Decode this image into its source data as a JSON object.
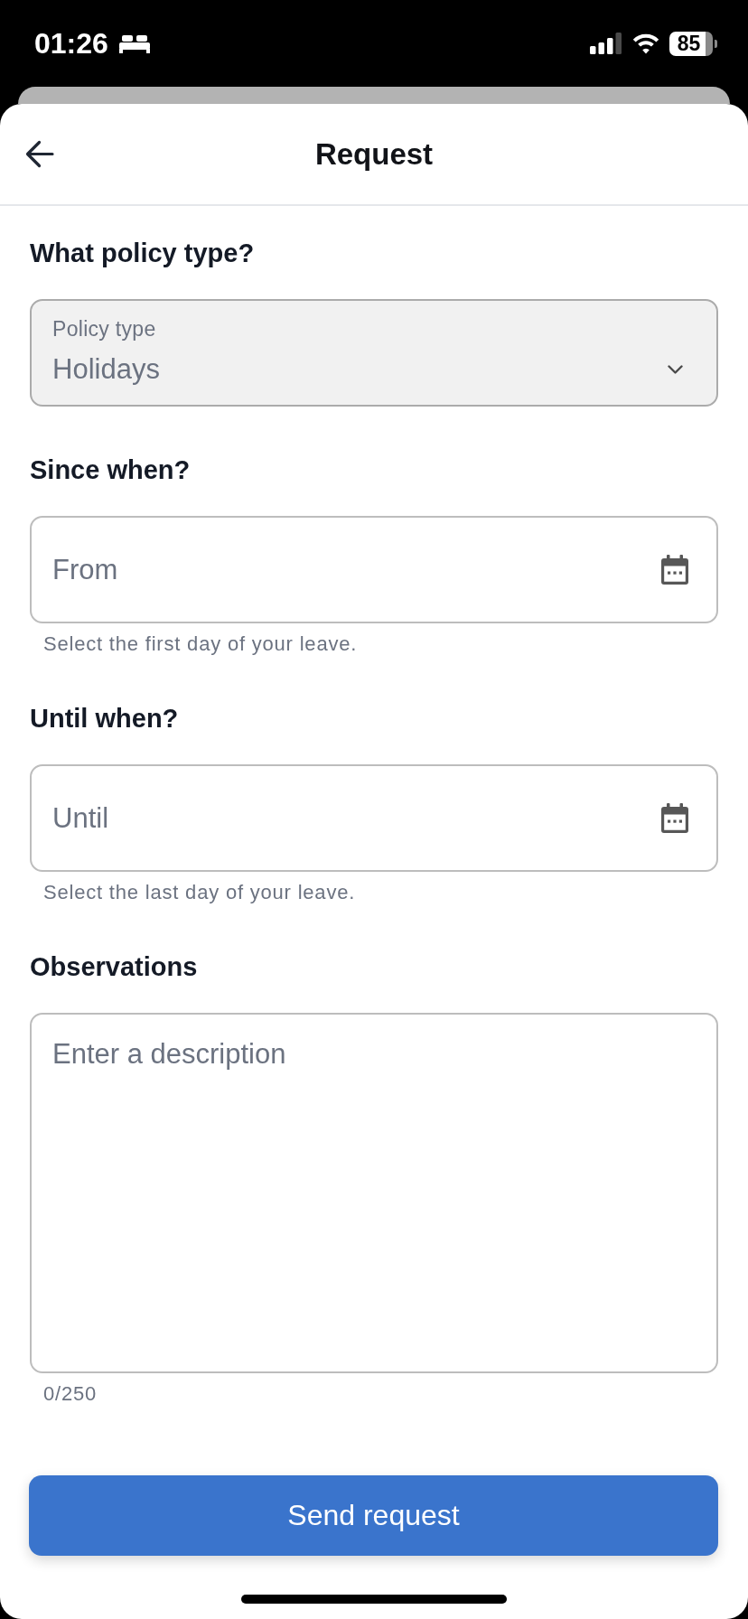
{
  "status_bar": {
    "time": "01:26",
    "battery": "85"
  },
  "header": {
    "title": "Request"
  },
  "sections": [
    {
      "kind": "select",
      "question": "What policy type?",
      "label": "Policy type",
      "value": "Holidays"
    },
    {
      "kind": "date",
      "question": "Since when?",
      "placeholder": "From",
      "helper": "Select the first day of your leave."
    },
    {
      "kind": "date",
      "question": "Until when?",
      "placeholder": "Until",
      "helper": "Select the last day of your leave."
    },
    {
      "kind": "textarea",
      "question": "Observations",
      "placeholder": "Enter a description",
      "counter": "0/250"
    }
  ],
  "submit_button": {
    "label": "Send request"
  }
}
